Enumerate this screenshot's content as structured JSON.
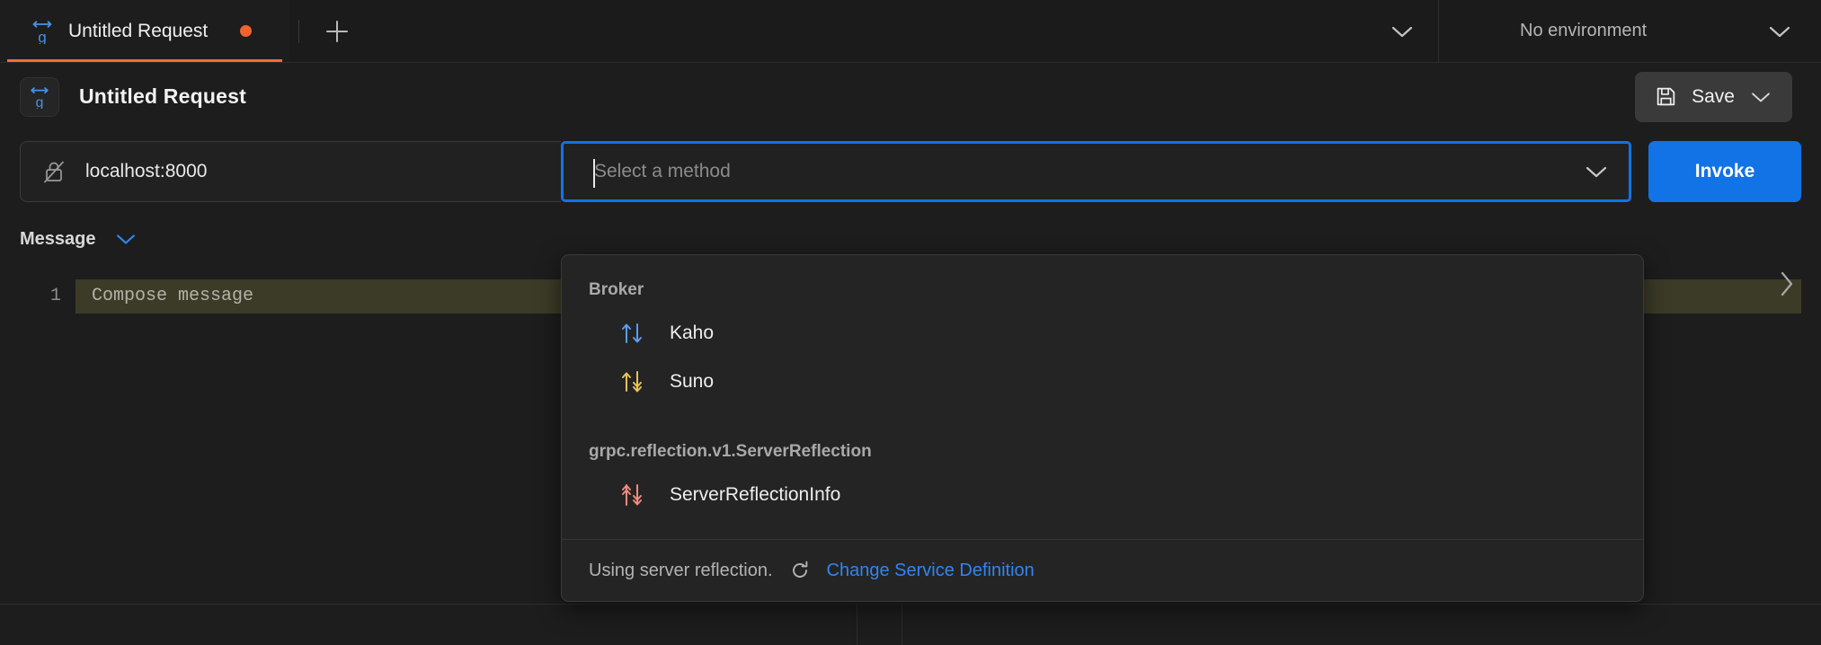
{
  "tabbar": {
    "tabs": [
      {
        "title": "Untitled Request",
        "icon": "grpc-icon",
        "unsaved": true,
        "active": true
      }
    ],
    "new_tab_icon": "plus-icon",
    "overflow_icon": "chevron-down-icon",
    "environment": {
      "label": "No environment",
      "icon": "chevron-down-icon"
    }
  },
  "request_header": {
    "icon": "grpc-icon",
    "title": "Untitled Request",
    "save": {
      "label": "Save",
      "icon": "floppy-disk-icon",
      "dropdown_icon": "chevron-down-icon"
    }
  },
  "url_row": {
    "lock_icon": "lock-crossed-icon",
    "url_value": "localhost:8000",
    "url_placeholder": "Enter URL",
    "method": {
      "value": "",
      "placeholder": "Select a method",
      "chevron_icon": "chevron-down-icon",
      "focused": true
    },
    "invoke_label": "Invoke"
  },
  "message_section": {
    "label": "Message",
    "collapse_icon": "chevron-down-icon",
    "editor": {
      "line_numbers": [
        "1"
      ],
      "placeholder": "Compose message"
    },
    "expand_panel_icon": "chevron-right-icon"
  },
  "method_dropdown": {
    "groups": [
      {
        "name": "Broker",
        "methods": [
          {
            "label": "Kaho",
            "icon": "unary-arrows-icon",
            "color": "#5b9df0"
          },
          {
            "label": "Suno",
            "icon": "server-streaming-arrows-icon",
            "color": "#e8c25a"
          }
        ]
      },
      {
        "name": "grpc.reflection.v1.ServerReflection",
        "methods": [
          {
            "label": "ServerReflectionInfo",
            "icon": "bidi-streaming-arrows-icon",
            "color": "#f08b80"
          }
        ]
      }
    ],
    "footer": {
      "text": "Using server reflection.",
      "refresh_icon": "refresh-icon",
      "link_label": "Change Service Definition"
    }
  },
  "colors": {
    "accent_orange": "#f2622e",
    "accent_blue": "#1273e6",
    "link_blue": "#2f86f0",
    "background": "#1d1d1d",
    "panel": "#242424"
  }
}
